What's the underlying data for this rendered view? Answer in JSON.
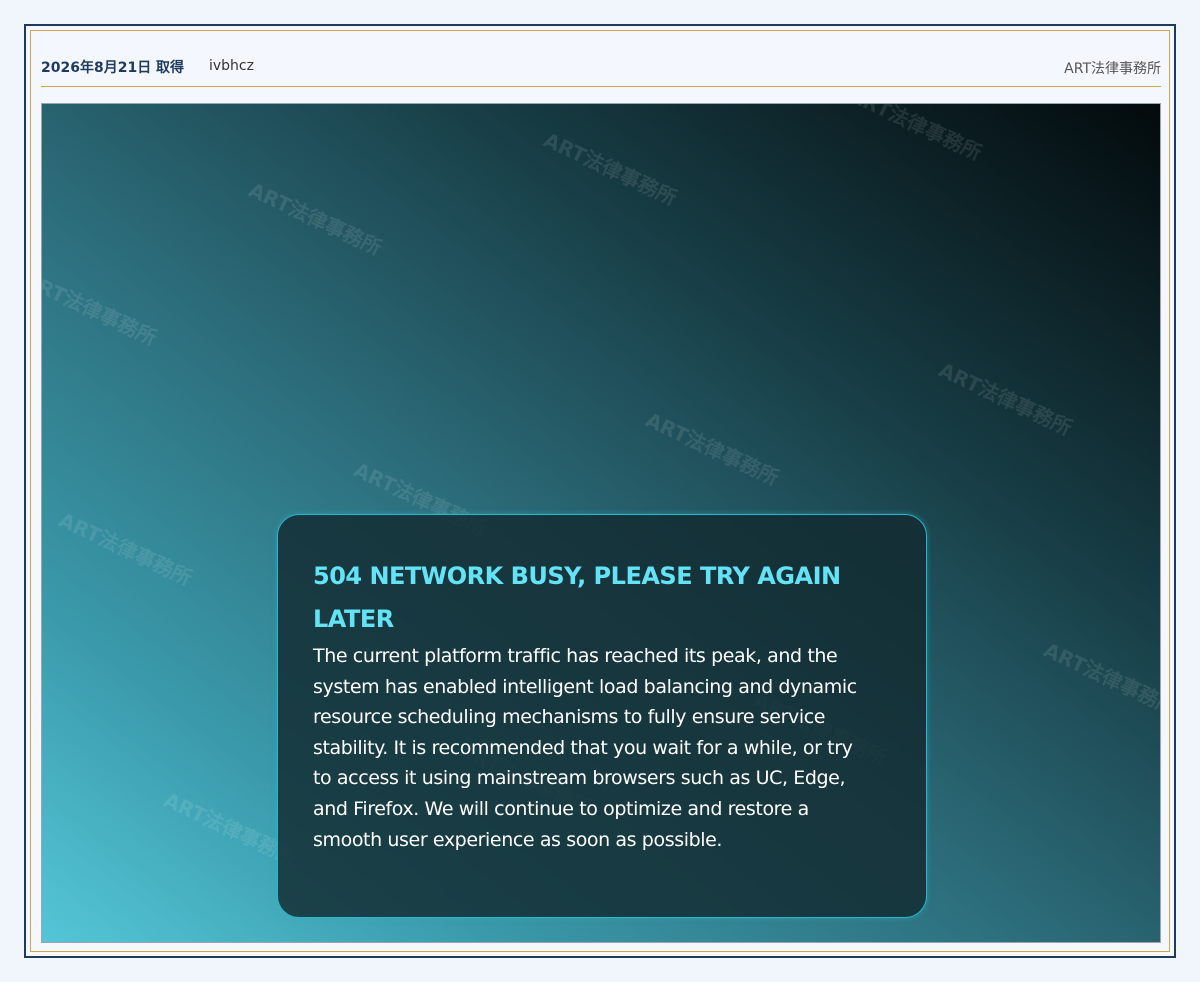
{
  "header": {
    "date": "2026年8月21日 取得",
    "user": "ivbhcz",
    "firm": "ART法律事務所"
  },
  "watermark": {
    "text": "ART法律事務所"
  },
  "error_card": {
    "title": "504 NETWORK BUSY, PLEASE TRY AGAIN LATER",
    "message": "The current platform traffic has reached its peak, and the system has enabled intelligent load balancing and dynamic resource scheduling mechanisms to fully ensure service stability. It is recommended that you wait for a while, or try to access it using mainstream browsers such as UC, Edge, and Firefox. We will continue to optimize and restore a smooth user experience as soon as possible."
  },
  "colors": {
    "frame_border": "#1e3a5f",
    "gold_rule": "#c9a94b",
    "title_accent": "#63e4f6",
    "card_border": "#2ab6cc"
  }
}
